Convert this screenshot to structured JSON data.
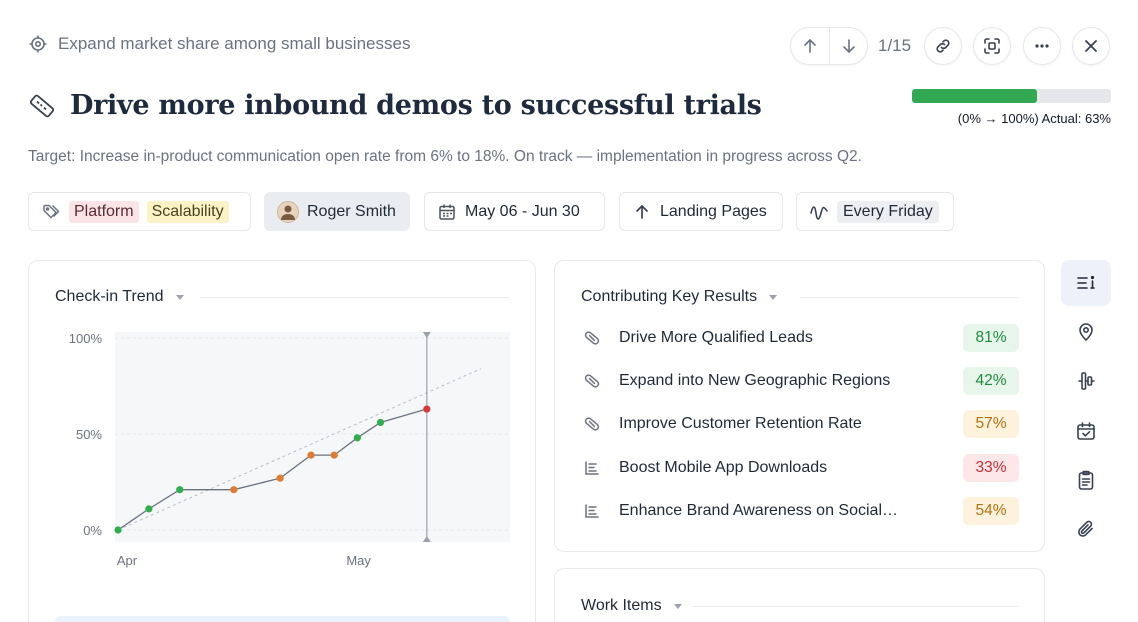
{
  "breadcrumb": {
    "label": "Expand market share among small businesses"
  },
  "pager": {
    "text": "1/15"
  },
  "progress": {
    "percent": 63,
    "label": "(0% → 100%) Actual: 63%",
    "color": "#31a852"
  },
  "title": "Drive more inbound demos to successful trials",
  "description": "Target: Increase in-product communication open rate from 6% to 18%. On track — implementation in progress across Q2.",
  "chips": {
    "tags": [
      {
        "label": "Platform",
        "bg": "#fbe3e6",
        "color": "#5b2a32"
      },
      {
        "label": "Scalability",
        "bg": "#fbf3c6",
        "color": "#4b4320"
      }
    ],
    "owner": "Roger Smith",
    "date_range": "May 06 - Jun 30",
    "alignment": "Landing Pages",
    "frequency": "Every Friday"
  },
  "checkin": {
    "title": "Check-in Trend"
  },
  "chart_data": {
    "type": "line",
    "x_ticks": [
      "Apr",
      "May"
    ],
    "y_ticks": [
      "100%",
      "50%",
      "0%"
    ],
    "ylim": [
      0,
      100
    ],
    "x_range_days": [
      0,
      43
    ],
    "points": [
      {
        "x": 0,
        "y": 0,
        "status": "green"
      },
      {
        "x": 4,
        "y": 11,
        "status": "green"
      },
      {
        "x": 8,
        "y": 21,
        "status": "green"
      },
      {
        "x": 15,
        "y": 21,
        "status": "orange"
      },
      {
        "x": 21,
        "y": 27,
        "status": "orange"
      },
      {
        "x": 25,
        "y": 39,
        "status": "orange"
      },
      {
        "x": 28,
        "y": 39,
        "status": "orange"
      },
      {
        "x": 31,
        "y": 48,
        "status": "green"
      },
      {
        "x": 34,
        "y": 56,
        "status": "green"
      },
      {
        "x": 40,
        "y": 63,
        "status": "red"
      }
    ],
    "target_line": {
      "from": [
        0,
        0
      ],
      "to": [
        47,
        84
      ]
    },
    "today_marker_x": 40,
    "colors": {
      "green": "#2fae4e",
      "orange": "#e07b2f",
      "red": "#d9383a",
      "line": "#6b7280"
    }
  },
  "key_results": {
    "title": "Contributing Key Results",
    "items": [
      {
        "label": "Drive More Qualified Leads",
        "pct": "81%",
        "icon": "link-icon",
        "bg": "#e6f6ea",
        "color": "#1f8a3e"
      },
      {
        "label": "Expand into New Geographic Regions",
        "pct": "42%",
        "icon": "link-icon",
        "bg": "#e6f6ea",
        "color": "#1f8a3e"
      },
      {
        "label": "Improve Customer Retention Rate",
        "pct": "57%",
        "icon": "link-icon",
        "bg": "#fdf3dc",
        "color": "#b5700f"
      },
      {
        "label": "Boost Mobile App Downloads",
        "pct": "33%",
        "icon": "list-icon",
        "bg": "#fde7e8",
        "color": "#c62f38"
      },
      {
        "label": "Enhance Brand Awareness on Social…",
        "pct": "54%",
        "icon": "list-icon",
        "bg": "#fdf3dc",
        "color": "#b5700f"
      }
    ]
  },
  "work_items": {
    "title": "Work Items"
  }
}
